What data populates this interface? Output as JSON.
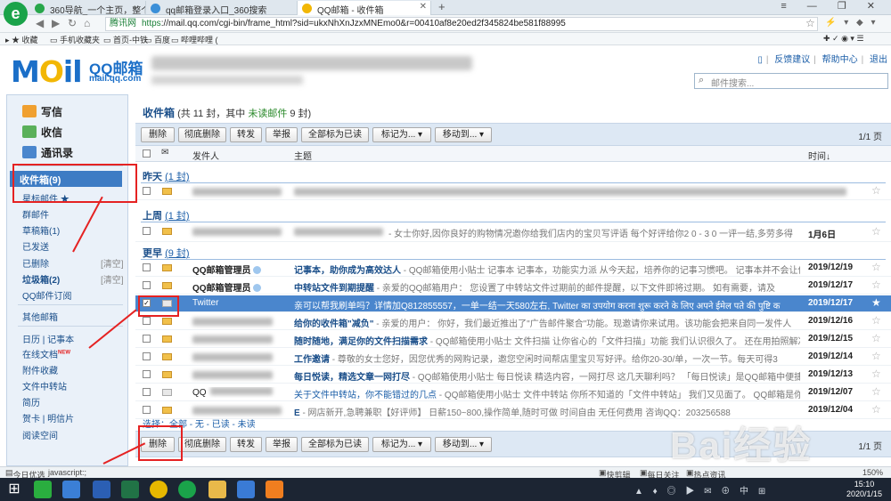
{
  "browser": {
    "tabs": [
      {
        "label": "360导航_一个主页，整个世界"
      },
      {
        "label": "qq邮箱登录入口_360搜索"
      },
      {
        "label": "QQ邮箱 - 收件箱"
      }
    ],
    "new_tab": "+",
    "window_controls": "≡ — ❐ ✕",
    "nav_back": "◀",
    "nav_forward": "▶",
    "nav_refresh": "↻",
    "nav_home": "⌂",
    "nav_star": "☆",
    "site_label": "腾讯网",
    "url_scheme": "https",
    "url": "://mail.qq.com/cgi-bin/frame_html?sid=ukxNhXnJzxMNEmo0&r=00410af8e20ed2f345824be581f88995",
    "addr_right": "⚡ ▾ ◆ ▾",
    "favorites": [
      "收藏",
      "手机收藏夹",
      "首页-中铁",
      "百度",
      "哔哩哔哩 ("
    ],
    "fav_right": "✚ ✓ ◉ ▾ ☰"
  },
  "mail": {
    "brand_en": "M",
    "brand_o": "O",
    "brand_il": "il",
    "brand_cn": "QQ邮箱",
    "brand_url": "mail.qq.com",
    "top_links": [
      "反馈建议",
      "帮助中心",
      "退出"
    ],
    "search_placeholder": "邮件搜索...",
    "nav_main": [
      "写信",
      "收信",
      "通讯录"
    ],
    "inbox_label": "收件箱(9)",
    "folders": [
      {
        "label": "星标邮件 ★"
      },
      {
        "label": "群邮件"
      },
      {
        "label": "草稿箱(1)"
      },
      {
        "label": "已发送"
      },
      {
        "label": "已删除",
        "action": "[清空]"
      },
      {
        "label": "垃圾箱(2)",
        "action": "[清空]"
      },
      {
        "label": "QQ邮件订阅"
      }
    ],
    "other_label": "其他邮箱",
    "tools": [
      {
        "label": "日历 | 记事本"
      },
      {
        "label": "在线文档",
        "badge": "NEW"
      },
      {
        "label": "附件收藏"
      },
      {
        "label": "文件中转站"
      },
      {
        "label": "简历"
      },
      {
        "label": "贺卡 | 明信片"
      },
      {
        "label": "阅读空间"
      }
    ],
    "title_folder": "收件箱",
    "title_count": " (共 11 封，其中 ",
    "title_unread": "未读邮件",
    "title_tail": " 9 封)",
    "buttons": [
      "删除",
      "彻底删除",
      "转发",
      "举报",
      "全部标为已读",
      "标记为... ▾",
      "移动到... ▾"
    ],
    "pager": "1/1 页",
    "columns": {
      "from": "发件人",
      "subject": "主题",
      "time": "时间↓"
    },
    "groups": [
      {
        "name": "昨天",
        "count": "(1 封)"
      },
      {
        "name": "上周",
        "count": "(1 封)"
      },
      {
        "name": "更早",
        "count": "(9 封)"
      }
    ],
    "emails": [
      {
        "from": "",
        "subject": "",
        "summary": "",
        "time": "",
        "read": false
      },
      {
        "from": "",
        "subject": "",
        "summary": "- 女士你好,因你良好的购物情况邀你给我们店内的宝贝写评语 每个好评给你2 0 - 3 0 一评一结,多劳多得",
        "time": "1月6日",
        "read": false
      },
      {
        "from": "QQ邮箱管理员",
        "subject": "记事本，助你成为高效达人",
        "summary": " - QQ邮箱使用小贴士 记事本 记事本，功能实力派 从今天起，培养你的记事习惯吧。 记事本并不会让你的…",
        "time": "2019/12/19",
        "read": false
      },
      {
        "from": "QQ邮箱管理员",
        "subject": "中转站文件到期提醒",
        "summary": " - 亲爱的QQ邮箱用户： 您设置了中转站文件过期前的邮件提醒，以下文件即将过期。 如有需要，请及",
        "time": "2019/12/17",
        "read": false
      },
      {
        "from": "Twitter",
        "subject": "",
        "summary": "亲可以帮我刷单吗？详情加Q812855557，一单一结一天580左右, Twitter का उपयोग करना शुरू करने के लिए अपने ईमेल पते की पुष्टि क",
        "time": "2019/12/17",
        "read": true
      },
      {
        "from": "",
        "subject": "给你的收件箱\"减负\"",
        "summary": " - 亲爱的用户： 你好，我们最近推出了\"广告邮件聚合\"功能。现邀请你来试用。该功能会把来自同一发件人",
        "time": "2019/12/16",
        "read": false
      },
      {
        "from": "",
        "subject": "随时随地，满足你的文件扫描需求",
        "summary": " - QQ邮箱使用小贴士 文件扫描 让你省心的「文件扫描」功能 我们认识很久了。 还在用拍照解决文…",
        "time": "2019/12/15",
        "read": false
      },
      {
        "from": "",
        "subject": "工作邀请",
        "summary": " - 尊敬的女士您好，因您优秀的网购记录，邀您空闲时间帮店里宝贝写好评。给你20-30/单，一次一节。每天可得3",
        "time": "2019/12/14",
        "read": false
      },
      {
        "from": "",
        "subject": "每日悦读，精选文章一网打尽",
        "summary": " - QQ邮箱使用小贴士 每日悦读 精选内容，一网打尽 这几天聊利吗？ 「每日悦读」是QQ邮箱中便捷的…",
        "time": "2019/12/13",
        "read": false
      },
      {
        "from": "QQ",
        "subject": "关于文件中转站，你不能错过的几点",
        "summary": " - QQ邮箱使用小贴士 文件中转站 你所不知道的「文件中转站」 我们又见面了。 QQ邮箱是你的移…",
        "time": "2019/12/07",
        "read": true
      },
      {
        "from": "",
        "subject": "E",
        "summary": " - 网店新开,急聘兼职【好评师】 日薪150~800,操作简单,随时可做 时间自由 无任何费用 咨询QQ：203256588",
        "time": "2019/12/04",
        "read": false
      }
    ],
    "bottom_select": "选择：全部 - 无 - 已读 - 未读"
  },
  "status": {
    "left": "今日优选",
    "js": "javascript:;",
    "mid": [
      "快剪辑",
      "每日关注",
      "热点资讯"
    ],
    "zoom": "150%"
  },
  "taskbar": {
    "time": "15:10",
    "date": "2020/1/15",
    "tray": "▲ ♦ ◎ ▶ ✉ ⊕ 中 ⊞"
  },
  "watermark": "Bai经验"
}
